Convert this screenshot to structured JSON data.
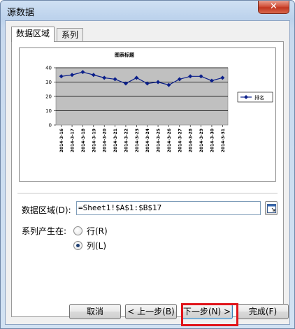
{
  "window": {
    "title": "源数据",
    "close_label": "✕"
  },
  "tabs": [
    {
      "label": "数据区域",
      "active": true
    },
    {
      "label": "系列",
      "active": false
    }
  ],
  "chart_data": {
    "type": "line",
    "title": "图表标题",
    "categories": [
      "2014-3-16",
      "2014-3-17",
      "2014-3-18",
      "2014-3-19",
      "2014-3-20",
      "2014-3-21",
      "2014-3-22",
      "2014-3-23",
      "2014-3-24",
      "2014-3-25",
      "2014-3-26",
      "2014-3-27",
      "2014-3-28",
      "2014-3-29",
      "2014-3-30",
      "2014-3-31"
    ],
    "series": [
      {
        "name": "排名",
        "values": [
          34,
          35,
          37,
          35,
          33,
          32,
          29,
          33,
          29,
          30,
          28,
          32,
          34,
          34,
          31,
          33
        ],
        "color": "#0b1f8a"
      }
    ],
    "y_ticks": [
      "0",
      "10",
      "20",
      "30",
      "40"
    ],
    "ylim": [
      0,
      40
    ],
    "grid": true,
    "plot_background": "#c0c0c0",
    "legend_position": "right"
  },
  "form": {
    "range_label": "数据区域(D):",
    "range_value": "=Sheet1!$A$1:$B$17",
    "series_in_label": "系列产生在:",
    "option_rows": "行(R)",
    "option_columns": "列(L)",
    "selected": "columns"
  },
  "buttons": {
    "cancel": "取消",
    "back": "< 上一步(B)",
    "next": "下一步(N) >",
    "finish": "完成(F)"
  },
  "colors": {
    "highlight": "#e0141a",
    "close_button": "#c1361f"
  }
}
